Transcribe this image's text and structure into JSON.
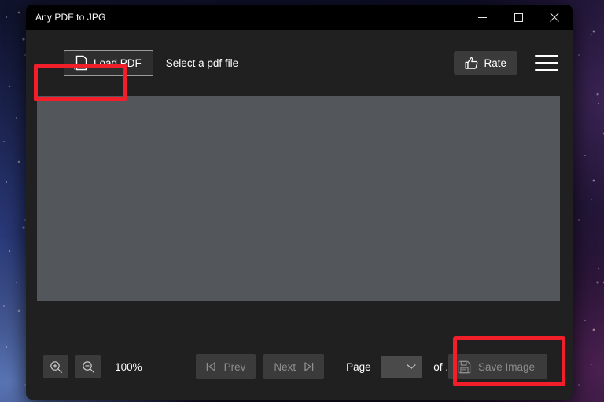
{
  "window": {
    "title": "Any PDF to JPG",
    "controls": {
      "minimize": "minimize-icon",
      "maximize": "maximize-icon",
      "close": "close-icon"
    }
  },
  "toolbar": {
    "load_pdf_label": "Load PDF",
    "load_pdf_icon": "load-document-icon",
    "status_text": "Select a pdf file",
    "rate_label": "Rate",
    "rate_icon": "thumbs-up-icon",
    "menu_icon": "hamburger-menu-icon"
  },
  "preview": {
    "canvas_color": "#53565a",
    "content": ""
  },
  "bottom_bar": {
    "zoom_in_icon": "zoom-in-icon",
    "zoom_out_icon": "zoom-out-icon",
    "zoom_level": "100%",
    "prev_label": "Prev",
    "prev_icon": "first-page-icon",
    "next_label": "Next",
    "next_icon": "last-page-icon",
    "page_label": "Page",
    "page_value": "",
    "page_dropdown_icon": "chevron-down-icon",
    "page_total": "of .",
    "save_label": "Save Image",
    "save_icon": "floppy-disk-icon"
  },
  "annotations": {
    "highlight_color": "#f21f2b",
    "load_pdf_target": "Load PDF",
    "save_image_target": "Save Image"
  },
  "theme": {
    "window_background": "#202020",
    "title_bar_background": "#000000",
    "button_background": "#3b3b3b",
    "text_color": "#ffffff",
    "disabled_text_color": "#8e8e8e"
  }
}
